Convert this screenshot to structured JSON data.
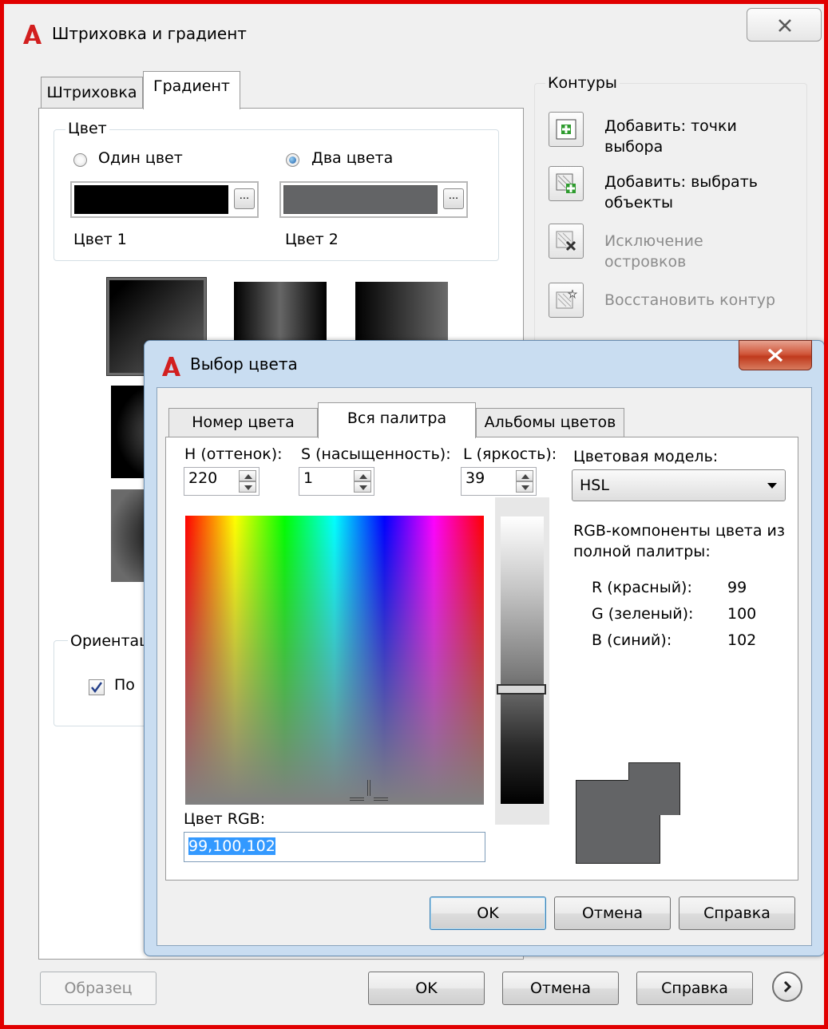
{
  "main_window": {
    "title": "Штриховка и градиент",
    "tabs": [
      "Штриховка",
      "Градиент"
    ],
    "color_group": {
      "label": "Цвет",
      "one_color": "Один цвет",
      "two_colors": "Два цвета",
      "color1_label": "Цвет 1",
      "color2_label": "Цвет 2",
      "dots": "...",
      "color1_value": "#000000",
      "color2_value": "#636466"
    },
    "orientation": {
      "label": "Ориентац",
      "center_checkbox": "По"
    },
    "contours": {
      "label": "Контуры",
      "add_points": "Добавить: точки выбора",
      "add_objects": "Добавить: выбрать объекты",
      "exclude_islands": "Исключение островков",
      "restore_contour": "Восстановить контур"
    },
    "buttons": {
      "sample": "Образец",
      "ok": "OK",
      "cancel": "Отмена",
      "help": "Справка"
    }
  },
  "color_dialog": {
    "title": "Выбор цвета",
    "tabs": [
      "Номер цвета",
      "Вся палитра",
      "Альбомы цветов"
    ],
    "h_label": "H (оттенок):",
    "s_label": "S (насыщенность):",
    "l_label": "L (яркость):",
    "h_value": "220",
    "s_value": "1",
    "l_value": "39",
    "model_label": "Цветовая модель:",
    "model_value": "HSL",
    "rgb_components_label": "RGB-компоненты цвета из полной палитры:",
    "r_label": "R (красный):",
    "g_label": "G (зеленый):",
    "b_label": "B (синий):",
    "r_value": "99",
    "g_value": "100",
    "b_value": "102",
    "rgb_label": "Цвет RGB:",
    "rgb_value": "99,100,102",
    "buttons": {
      "ok": "OK",
      "cancel": "Отмена",
      "help": "Справка"
    }
  }
}
